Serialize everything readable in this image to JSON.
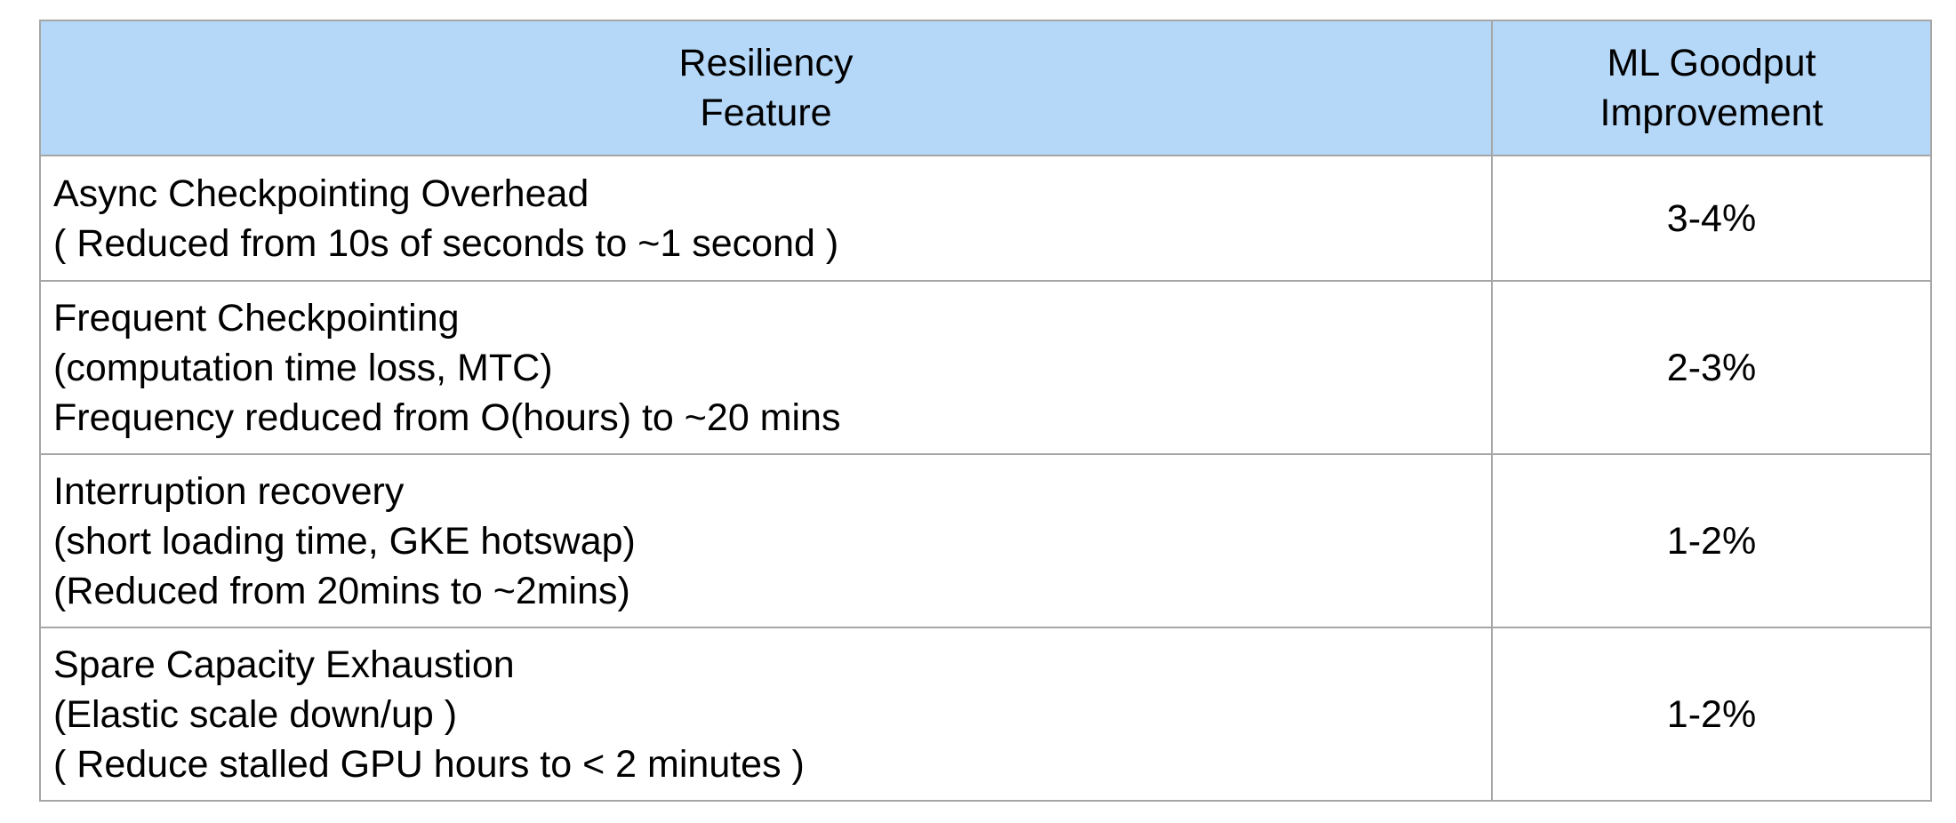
{
  "table": {
    "header": {
      "feature_line1": "Resiliency",
      "feature_line2": "Feature",
      "improvement_line1": "ML Goodput",
      "improvement_line2": "Improvement"
    },
    "rows": [
      {
        "lines": [
          "Async Checkpointing Overhead",
          "( Reduced from 10s of seconds to ~1 second )"
        ],
        "improvement": "3-4%"
      },
      {
        "lines": [
          "Frequent Checkpointing",
          "(computation time loss, MTC)",
          "Frequency reduced from O(hours) to ~20 mins"
        ],
        "improvement": "2-3%"
      },
      {
        "lines": [
          "Interruption recovery",
          "(short loading time, GKE hotswap)",
          "(Reduced from 20mins to ~2mins)"
        ],
        "improvement": "1-2%"
      },
      {
        "lines": [
          "Spare Capacity Exhaustion",
          "(Elastic scale down/up )",
          "( Reduce stalled GPU hours to < 2 minutes )"
        ],
        "improvement": "1-2%"
      }
    ],
    "colors": {
      "header_background": "#b5d8f9",
      "border": "#a6a6a6"
    }
  }
}
